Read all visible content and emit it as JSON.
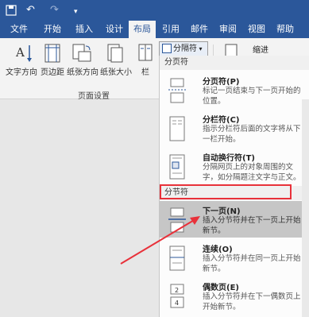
{
  "quick_access": {
    "undo_icon": "undo-icon",
    "redo_icon": "redo-icon",
    "more_icon": "customize-icon"
  },
  "tabs": [
    {
      "label": "文件"
    },
    {
      "label": "开始"
    },
    {
      "label": "插入"
    },
    {
      "label": "设计"
    },
    {
      "label": "布局"
    },
    {
      "label": "引用"
    },
    {
      "label": "邮件"
    },
    {
      "label": "审阅"
    },
    {
      "label": "视图"
    },
    {
      "label": "帮助"
    }
  ],
  "ribbon": {
    "text_direction": "文字方向",
    "margins": "页边距",
    "orientation": "纸张方向",
    "size": "纸张大小",
    "columns": "栏",
    "group_label": "页面设置",
    "breaks_button": "分隔符",
    "indent": "缩进"
  },
  "menu": {
    "page_breaks_header": "分页符",
    "section_breaks_header": "分节符",
    "items": [
      {
        "title": "分页符(P)",
        "desc": "标记一页结束与下一页开始的位置。",
        "icon": "page-break-icon"
      },
      {
        "title": "分栏符(C)",
        "desc": "指示分栏符后面的文字将从下一栏开始。",
        "icon": "column-break-icon"
      },
      {
        "title": "自动换行符(T)",
        "desc": "分隔网页上的对象周围的文字，如分隔题注文字与正文。",
        "icon": "text-wrapping-break-icon"
      },
      {
        "title": "下一页(N)",
        "desc": "插入分节符并在下一页上开始新节。",
        "icon": "next-page-break-icon"
      },
      {
        "title": "连续(O)",
        "desc": "插入分节符并在同一页上开始新节。",
        "icon": "continuous-break-icon"
      },
      {
        "title": "偶数页(E)",
        "desc": "插入分节符并在下一偶数页上开始新节。",
        "icon": "even-page-break-icon"
      }
    ]
  },
  "colors": {
    "brand": "#2b579a",
    "highlight": "#e8313a"
  }
}
